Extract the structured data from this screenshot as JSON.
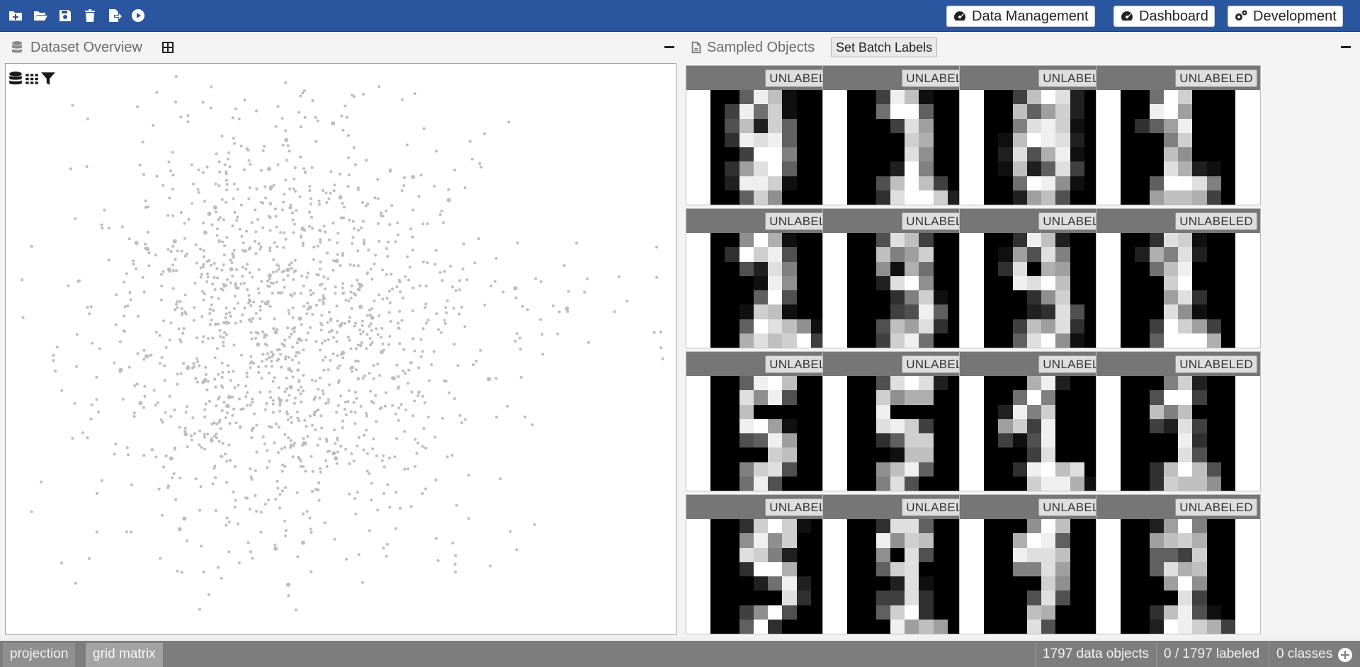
{
  "toolbar": {
    "icons": [
      "new-project-icon",
      "open-folder-icon",
      "save-icon",
      "delete-icon",
      "export-icon",
      "run-icon"
    ],
    "nav_buttons": [
      {
        "label": "Data Management",
        "icon": "speedometer-icon"
      },
      {
        "label": "Dashboard",
        "icon": "speedometer-icon"
      },
      {
        "label": "Development",
        "icon": "gears-icon"
      }
    ]
  },
  "overview": {
    "title": "Dataset Overview",
    "tools": [
      "database-icon",
      "grid-icon",
      "filter-icon"
    ],
    "point_color": "#bdbdbd"
  },
  "sampled": {
    "title": "Sampled Objects",
    "batch_button": "Set Batch Labels",
    "label": "UNLABELED",
    "cards": [
      {
        "label": "UNLABELED",
        "pixels": [
          0,
          0,
          6,
          15,
          12,
          1,
          0,
          0,
          0,
          4,
          15,
          7,
          13,
          1,
          0,
          0,
          0,
          5,
          12,
          2,
          13,
          6,
          0,
          0,
          0,
          3,
          15,
          14,
          15,
          6,
          0,
          0,
          0,
          0,
          4,
          16,
          16,
          8,
          0,
          0,
          0,
          3,
          10,
          14,
          16,
          6,
          0,
          0,
          0,
          2,
          15,
          15,
          13,
          1,
          0,
          0,
          0,
          0,
          6,
          13,
          9,
          0,
          0,
          0
        ]
      },
      {
        "label": "UNLABELED",
        "pixels": [
          0,
          0,
          4,
          15,
          12,
          1,
          0,
          0,
          0,
          0,
          7,
          16,
          16,
          6,
          0,
          0,
          0,
          0,
          0,
          4,
          14,
          10,
          0,
          0,
          0,
          0,
          0,
          0,
          13,
          11,
          0,
          0,
          0,
          0,
          0,
          0,
          14,
          9,
          0,
          0,
          0,
          0,
          0,
          2,
          16,
          8,
          0,
          0,
          0,
          0,
          5,
          12,
          16,
          12,
          4,
          0,
          0,
          0,
          3,
          14,
          16,
          16,
          13,
          2
        ]
      },
      {
        "label": "UNLABELED",
        "pixels": [
          0,
          0,
          4,
          12,
          16,
          14,
          2,
          0,
          0,
          0,
          12,
          6,
          10,
          13,
          2,
          0,
          0,
          0,
          8,
          14,
          15,
          13,
          1,
          0,
          0,
          1,
          12,
          16,
          15,
          14,
          2,
          0,
          0,
          2,
          14,
          5,
          11,
          15,
          1,
          0,
          0,
          1,
          12,
          2,
          6,
          14,
          4,
          0,
          0,
          0,
          7,
          16,
          15,
          9,
          1,
          0,
          0,
          0,
          2,
          10,
          12,
          5,
          0,
          0
        ]
      },
      {
        "label": "UNLABELED",
        "pixels": [
          0,
          0,
          7,
          16,
          13,
          0,
          0,
          0,
          0,
          0,
          15,
          16,
          10,
          0,
          0,
          0,
          0,
          3,
          6,
          10,
          15,
          0,
          0,
          0,
          0,
          0,
          0,
          8,
          13,
          0,
          0,
          0,
          0,
          0,
          0,
          12,
          9,
          0,
          0,
          0,
          0,
          0,
          0,
          14,
          11,
          2,
          1,
          0,
          0,
          0,
          6,
          16,
          16,
          14,
          8,
          0,
          0,
          0,
          10,
          12,
          12,
          11,
          4,
          0
        ]
      },
      {
        "label": "UNLABELED",
        "pixels": [
          0,
          0,
          9,
          16,
          11,
          1,
          0,
          0,
          0,
          3,
          16,
          13,
          15,
          5,
          0,
          0,
          0,
          0,
          5,
          2,
          14,
          8,
          0,
          0,
          0,
          0,
          0,
          1,
          15,
          9,
          0,
          0,
          0,
          0,
          0,
          6,
          16,
          5,
          0,
          0,
          0,
          0,
          1,
          13,
          12,
          1,
          0,
          0,
          0,
          0,
          6,
          16,
          14,
          12,
          9,
          1,
          0,
          0,
          11,
          14,
          12,
          13,
          16,
          4
        ]
      },
      {
        "label": "UNLABELED",
        "pixels": [
          0,
          0,
          5,
          14,
          12,
          4,
          0,
          0,
          0,
          0,
          12,
          8,
          10,
          13,
          0,
          0,
          0,
          0,
          9,
          1,
          11,
          7,
          0,
          0,
          0,
          0,
          2,
          14,
          16,
          9,
          0,
          0,
          0,
          0,
          0,
          3,
          8,
          13,
          1,
          0,
          0,
          0,
          0,
          4,
          5,
          15,
          6,
          0,
          0,
          0,
          5,
          12,
          10,
          14,
          3,
          0,
          0,
          0,
          4,
          13,
          15,
          7,
          0,
          0
        ]
      },
      {
        "label": "UNLABELED",
        "pixels": [
          0,
          0,
          3,
          15,
          12,
          2,
          0,
          0,
          0,
          1,
          10,
          5,
          14,
          8,
          0,
          0,
          0,
          3,
          14,
          0,
          11,
          10,
          0,
          0,
          0,
          0,
          15,
          14,
          16,
          12,
          0,
          0,
          0,
          0,
          0,
          3,
          9,
          13,
          0,
          0,
          0,
          0,
          0,
          2,
          3,
          14,
          5,
          0,
          0,
          0,
          4,
          12,
          10,
          14,
          3,
          0,
          0,
          0,
          6,
          14,
          16,
          9,
          1,
          0
        ]
      },
      {
        "label": "UNLABELED",
        "pixels": [
          0,
          0,
          3,
          14,
          13,
          1,
          0,
          0,
          0,
          2,
          11,
          8,
          14,
          2,
          0,
          0,
          0,
          0,
          7,
          12,
          15,
          0,
          0,
          0,
          0,
          0,
          0,
          13,
          16,
          0,
          0,
          0,
          0,
          0,
          0,
          10,
          14,
          3,
          0,
          0,
          0,
          0,
          0,
          14,
          9,
          1,
          0,
          0,
          0,
          0,
          4,
          16,
          13,
          10,
          4,
          0,
          0,
          0,
          6,
          16,
          16,
          16,
          11,
          0
        ]
      },
      {
        "label": "UNLABELED",
        "pixels": [
          0,
          0,
          6,
          15,
          16,
          12,
          0,
          0,
          0,
          0,
          14,
          9,
          15,
          5,
          0,
          0,
          0,
          0,
          12,
          0,
          0,
          0,
          0,
          0,
          0,
          0,
          15,
          16,
          10,
          1,
          0,
          0,
          0,
          0,
          5,
          6,
          15,
          10,
          0,
          0,
          0,
          0,
          0,
          0,
          13,
          12,
          0,
          0,
          0,
          0,
          8,
          13,
          14,
          5,
          0,
          0,
          0,
          0,
          7,
          15,
          5,
          0,
          0,
          0
        ]
      },
      {
        "label": "UNLABELED",
        "pixels": [
          0,
          0,
          5,
          14,
          16,
          14,
          2,
          0,
          0,
          0,
          13,
          9,
          11,
          11,
          0,
          0,
          0,
          0,
          15,
          0,
          0,
          0,
          0,
          0,
          0,
          0,
          14,
          15,
          13,
          4,
          0,
          0,
          0,
          0,
          3,
          6,
          13,
          13,
          0,
          0,
          0,
          0,
          0,
          1,
          12,
          12,
          0,
          0,
          0,
          0,
          9,
          12,
          15,
          6,
          0,
          0,
          0,
          0,
          8,
          14,
          5,
          0,
          0,
          0
        ]
      },
      {
        "label": "UNLABELED",
        "pixels": [
          0,
          0,
          0,
          11,
          15,
          2,
          0,
          0,
          0,
          0,
          7,
          16,
          8,
          0,
          0,
          0,
          0,
          2,
          15,
          8,
          13,
          0,
          0,
          0,
          0,
          10,
          13,
          4,
          15,
          0,
          0,
          0,
          0,
          4,
          1,
          5,
          15,
          0,
          0,
          0,
          0,
          0,
          0,
          4,
          14,
          0,
          0,
          0,
          0,
          0,
          3,
          15,
          16,
          12,
          14,
          0,
          0,
          0,
          0,
          13,
          15,
          15,
          11,
          1
        ]
      },
      {
        "label": "UNLABELED",
        "pixels": [
          0,
          0,
          0,
          8,
          13,
          2,
          0,
          0,
          0,
          0,
          5,
          16,
          16,
          4,
          0,
          0,
          0,
          0,
          12,
          8,
          12,
          0,
          0,
          0,
          0,
          0,
          4,
          2,
          14,
          4,
          0,
          0,
          0,
          0,
          0,
          0,
          15,
          3,
          0,
          0,
          0,
          0,
          0,
          0,
          14,
          5,
          0,
          0,
          0,
          0,
          3,
          12,
          16,
          12,
          5,
          0,
          0,
          0,
          3,
          13,
          12,
          12,
          9,
          0
        ]
      },
      {
        "label": "UNLABELED",
        "pixels": [
          0,
          0,
          3,
          13,
          16,
          13,
          1,
          0,
          0,
          0,
          9,
          15,
          9,
          13,
          0,
          0,
          0,
          0,
          14,
          13,
          8,
          2,
          0,
          0,
          0,
          0,
          3,
          16,
          16,
          11,
          0,
          0,
          0,
          0,
          0,
          2,
          7,
          15,
          2,
          0,
          0,
          0,
          0,
          0,
          0,
          14,
          3,
          0,
          0,
          0,
          4,
          9,
          16,
          5,
          0,
          0,
          0,
          0,
          6,
          16,
          3,
          0,
          0,
          0
        ]
      },
      {
        "label": "UNLABELED",
        "pixels": [
          0,
          0,
          3,
          14,
          14,
          6,
          0,
          0,
          0,
          0,
          15,
          9,
          13,
          12,
          0,
          0,
          0,
          0,
          9,
          0,
          14,
          5,
          0,
          0,
          0,
          0,
          6,
          13,
          14,
          0,
          0,
          0,
          0,
          0,
          0,
          2,
          14,
          1,
          0,
          0,
          0,
          0,
          4,
          4,
          14,
          3,
          0,
          0,
          0,
          0,
          6,
          13,
          16,
          3,
          0,
          0,
          0,
          0,
          0,
          15,
          10,
          12,
          10,
          0
        ]
      },
      {
        "label": "UNLABELED",
        "pixels": [
          0,
          0,
          0,
          9,
          16,
          12,
          0,
          0,
          0,
          0,
          11,
          16,
          15,
          6,
          0,
          0,
          0,
          0,
          15,
          14,
          14,
          12,
          0,
          0,
          0,
          0,
          8,
          8,
          14,
          10,
          0,
          0,
          0,
          0,
          0,
          0,
          13,
          9,
          0,
          0,
          0,
          0,
          0,
          5,
          14,
          5,
          0,
          0,
          0,
          0,
          0,
          12,
          11,
          0,
          0,
          0,
          0,
          0,
          0,
          14,
          5,
          0,
          0,
          0
        ]
      },
      {
        "label": "UNLABELED",
        "pixels": [
          0,
          0,
          2,
          10,
          16,
          8,
          0,
          0,
          0,
          0,
          10,
          12,
          13,
          11,
          0,
          0,
          0,
          0,
          6,
          6,
          4,
          13,
          0,
          0,
          0,
          0,
          6,
          14,
          11,
          12,
          0,
          0,
          0,
          0,
          0,
          10,
          16,
          9,
          0,
          0,
          0,
          0,
          0,
          0,
          14,
          4,
          0,
          0,
          0,
          0,
          3,
          12,
          15,
          5,
          1,
          0,
          0,
          0,
          2,
          16,
          15,
          13,
          11,
          4
        ]
      }
    ]
  },
  "statusbar": {
    "tabs": [
      "projection",
      "grid matrix"
    ],
    "data_objects": "1797 data objects",
    "labeled": "0 / 1797 labeled",
    "classes": "0 classes",
    "add_icon": "plus-circle-icon"
  }
}
